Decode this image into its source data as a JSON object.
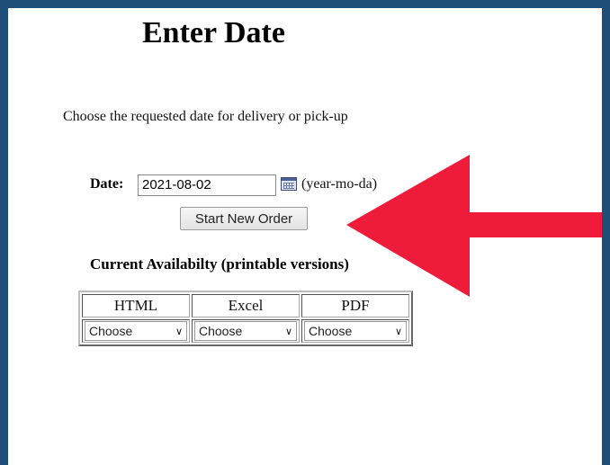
{
  "page": {
    "title": "Enter Date",
    "description": "Choose the requested date for delivery or pick-up"
  },
  "date_form": {
    "label": "Date:",
    "value": "2021-08-02",
    "format_hint": "(year-mo-da)",
    "calendar_icon": "calendar-icon",
    "submit_label": "Start New Order"
  },
  "availability": {
    "heading": "Current Availabilty (printable versions)",
    "columns": [
      {
        "header": "HTML",
        "select_value": "Choose"
      },
      {
        "header": "Excel",
        "select_value": "Choose"
      },
      {
        "header": "PDF",
        "select_value": "Choose"
      }
    ]
  },
  "annotation": {
    "arrow_icon": "arrow-left-icon",
    "arrow_color": "#ee1c3a"
  },
  "colors": {
    "frame_border": "#1f4e79"
  }
}
